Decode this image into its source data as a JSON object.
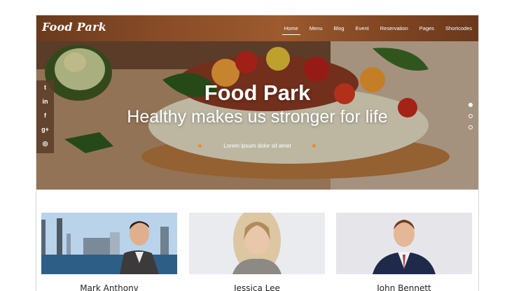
{
  "brand": {
    "logo": "Food Park"
  },
  "nav": {
    "items": [
      {
        "label": "Home",
        "active": true
      },
      {
        "label": "Menu"
      },
      {
        "label": "Blog"
      },
      {
        "label": "Event"
      },
      {
        "label": "Reservation"
      },
      {
        "label": "Pages"
      },
      {
        "label": "Shortcodes"
      }
    ]
  },
  "hero": {
    "title": "Food Park",
    "subtitle": "Healthy makes us stronger for life",
    "caption": "Lorem ipsum dolor sit amet",
    "slide_count": 3,
    "active_slide": 1
  },
  "social": {
    "icons": [
      "twitter-icon",
      "linkedin-icon",
      "facebook-icon",
      "google-plus-icon",
      "dribbble-icon"
    ],
    "glyphs": [
      "t",
      "in",
      "f",
      "g+",
      "◎"
    ]
  },
  "team": [
    {
      "name": "Mark Anthony"
    },
    {
      "name": "Jessica Lee"
    },
    {
      "name": "John Bennett"
    }
  ],
  "colors": {
    "accent": "#f08a24",
    "header": "#8a4d27"
  }
}
